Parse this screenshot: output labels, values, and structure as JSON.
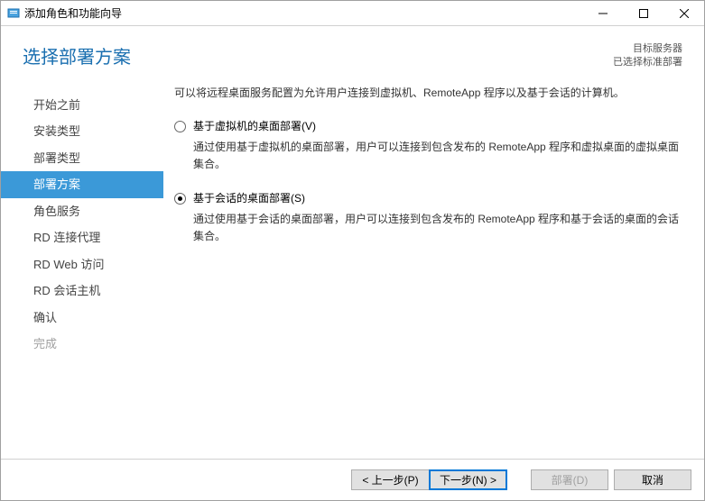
{
  "titlebar": {
    "title": "添加角色和功能向导"
  },
  "header": {
    "page_title": "选择部署方案",
    "target_label": "目标服务器",
    "target_sub": "已选择标准部署"
  },
  "sidebar": {
    "items": [
      {
        "label": "开始之前",
        "state": "normal"
      },
      {
        "label": "安装类型",
        "state": "normal"
      },
      {
        "label": "部署类型",
        "state": "normal"
      },
      {
        "label": "部署方案",
        "state": "active"
      },
      {
        "label": "角色服务",
        "state": "normal"
      },
      {
        "label": "RD 连接代理",
        "state": "normal"
      },
      {
        "label": "RD Web 访问",
        "state": "normal"
      },
      {
        "label": "RD 会话主机",
        "state": "normal"
      },
      {
        "label": "确认",
        "state": "normal"
      },
      {
        "label": "完成",
        "state": "disabled"
      }
    ]
  },
  "content": {
    "intro": "可以将远程桌面服务配置为允许用户连接到虚拟机、RemoteApp 程序以及基于会话的计算机。",
    "options": [
      {
        "label": "基于虚拟机的桌面部署(V)",
        "desc": "通过使用基于虚拟机的桌面部署，用户可以连接到包含发布的 RemoteApp 程序和虚拟桌面的虚拟桌面集合。",
        "checked": false
      },
      {
        "label": "基于会话的桌面部署(S)",
        "desc": "通过使用基于会话的桌面部署，用户可以连接到包含发布的 RemoteApp 程序和基于会话的桌面的会话集合。",
        "checked": true
      }
    ]
  },
  "footer": {
    "prev": "< 上一步(P)",
    "next": "下一步(N) >",
    "deploy": "部署(D)",
    "cancel": "取消"
  }
}
